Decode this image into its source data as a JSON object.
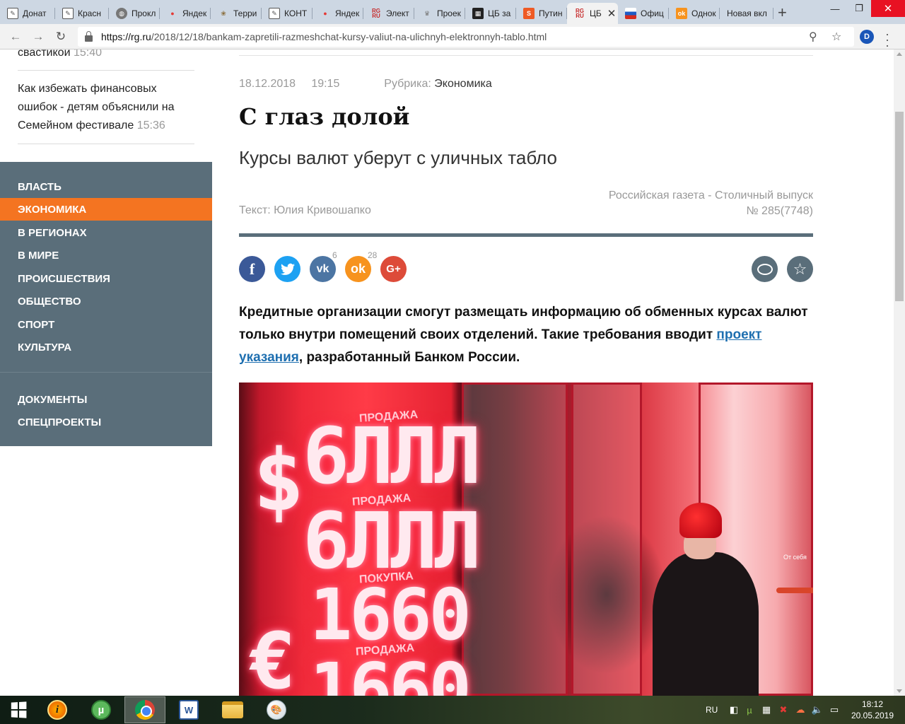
{
  "browser": {
    "tabs": [
      {
        "label": "Донат",
        "icon": "document-icon"
      },
      {
        "label": "Красн",
        "icon": "document-icon"
      },
      {
        "label": "Прокл",
        "icon": "globe-icon"
      },
      {
        "label": "Яндек",
        "icon": "map-pin-icon"
      },
      {
        "label": "Терри",
        "icon": "ornament-icon"
      },
      {
        "label": "КОНТ",
        "icon": "document-icon"
      },
      {
        "label": "Яндек",
        "icon": "map-pin-icon"
      },
      {
        "label": "Элект",
        "icon": "rg-logo-icon"
      },
      {
        "label": "Проек",
        "icon": "crest-icon"
      },
      {
        "label": "ЦБ за",
        "icon": "qr-icon"
      },
      {
        "label": "Путин",
        "icon": "s-logo-icon"
      },
      {
        "label": "ЦБ",
        "icon": "rg-logo-icon",
        "active": true
      },
      {
        "label": "Офиц",
        "icon": "russia-flag-icon"
      },
      {
        "label": "Однок",
        "icon": "ok-icon"
      },
      {
        "label": "Новая вкл",
        "icon": "none"
      }
    ],
    "url_host": "https://rg.ru",
    "url_path": "/2018/12/18/bankam-zapretili-razmeshchat-kursy-valiut-na-ulichnyh-elektronnyh-tablo.html",
    "profile_initial": "D"
  },
  "sidebar": {
    "news": [
      {
        "text": "свастикой",
        "time": "15:40"
      },
      {
        "text": "Как избежать финансовых ошибок - детям объяснили на Семейном фестивале",
        "time": "15:36"
      }
    ],
    "nav": [
      {
        "label": "Власть",
        "active": false
      },
      {
        "label": "Экономика",
        "active": true
      },
      {
        "label": "В регионах",
        "active": false
      },
      {
        "label": "В мире",
        "active": false
      },
      {
        "label": "Происшествия",
        "active": false
      },
      {
        "label": "Общество",
        "active": false
      },
      {
        "label": "Спорт",
        "active": false
      },
      {
        "label": "Культура",
        "active": false
      }
    ],
    "nav_extra": [
      {
        "label": "Документы"
      },
      {
        "label": "Спецпроекты"
      }
    ]
  },
  "article": {
    "date": "18.12.2018",
    "time": "19:15",
    "rubric_label": "Рубрика:",
    "rubric": "Экономика",
    "title": "С глаз долой",
    "subtitle": "Курсы валют уберут с уличных табло",
    "edition_line1": "Российская газета - Столичный выпуск",
    "edition_line2": "№ 285(7748)",
    "author": "Текст: Юлия Кривошапко",
    "share": {
      "vk_count": "6",
      "ok_count": "28"
    },
    "lead_part1": "Кредитные организации смогут размещать информацию об обменных курсах валют только внутри помещений своих отделений. Такие требования вводит ",
    "lead_link": "проект указания",
    "lead_part2": ", разработанный Банком России.",
    "photo": {
      "board_digits": [
        "6ЛЛЛ",
        "6ЛЛЛ",
        "1660",
        "1660"
      ],
      "board_labels": [
        "ПРОДАЖА",
        "ПОКУПКА",
        "ПРОДАЖА"
      ],
      "currency_symbols": [
        "$",
        "€"
      ],
      "door_sign": "От себя"
    }
  },
  "taskbar": {
    "language": "RU",
    "time": "18:12",
    "date": "20.05.2019"
  }
}
